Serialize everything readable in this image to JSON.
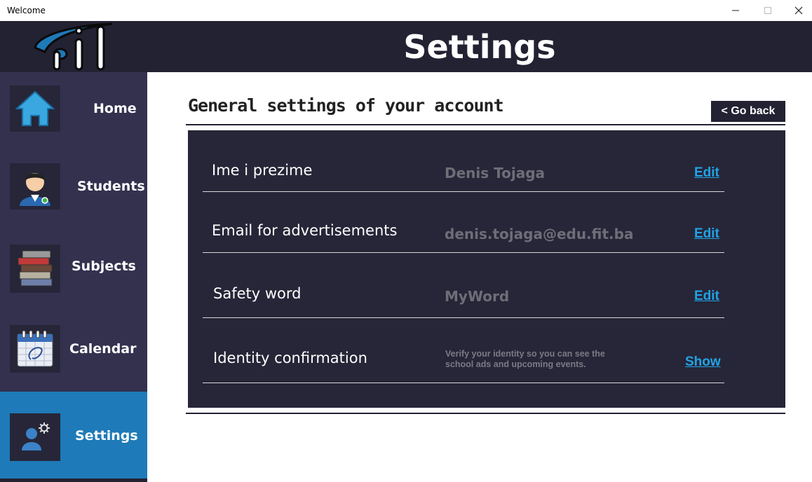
{
  "window": {
    "title": "Welcome",
    "controls": [
      "minimize",
      "maximize",
      "close"
    ]
  },
  "header": {
    "title": "Settings",
    "logo_icon": "fit-logo"
  },
  "sidebar": {
    "items": [
      {
        "label": "Home",
        "icon": "home-icon"
      },
      {
        "label": "Students",
        "icon": "student-avatar-icon"
      },
      {
        "label": "Subjects",
        "icon": "books-icon"
      },
      {
        "label": "Calendar",
        "icon": "calendar-icon"
      },
      {
        "label": "Settings",
        "icon": "user-settings-icon",
        "active": true
      }
    ]
  },
  "main": {
    "section_title": "General settings of your account",
    "go_back_label": "< Go back",
    "rows": [
      {
        "label": "Ime i prezime",
        "value": "Denis Tojaga",
        "action": "Edit"
      },
      {
        "label": "Email for advertisements",
        "value": "denis.tojaga@edu.fit.ba",
        "action": "Edit"
      },
      {
        "label": "Safety word",
        "value": "MyWord",
        "action": "Edit"
      },
      {
        "label": "Identity confirmation",
        "value": "Verify your identity so you can see the school ads and upcoming events.",
        "action": "Show"
      }
    ]
  },
  "colors": {
    "header_bg": "#222233",
    "sidebar_bg": "#34314f",
    "active_item_bg": "#1e7ab8",
    "panel_bg": "#262638",
    "link": "#21a3e6"
  }
}
